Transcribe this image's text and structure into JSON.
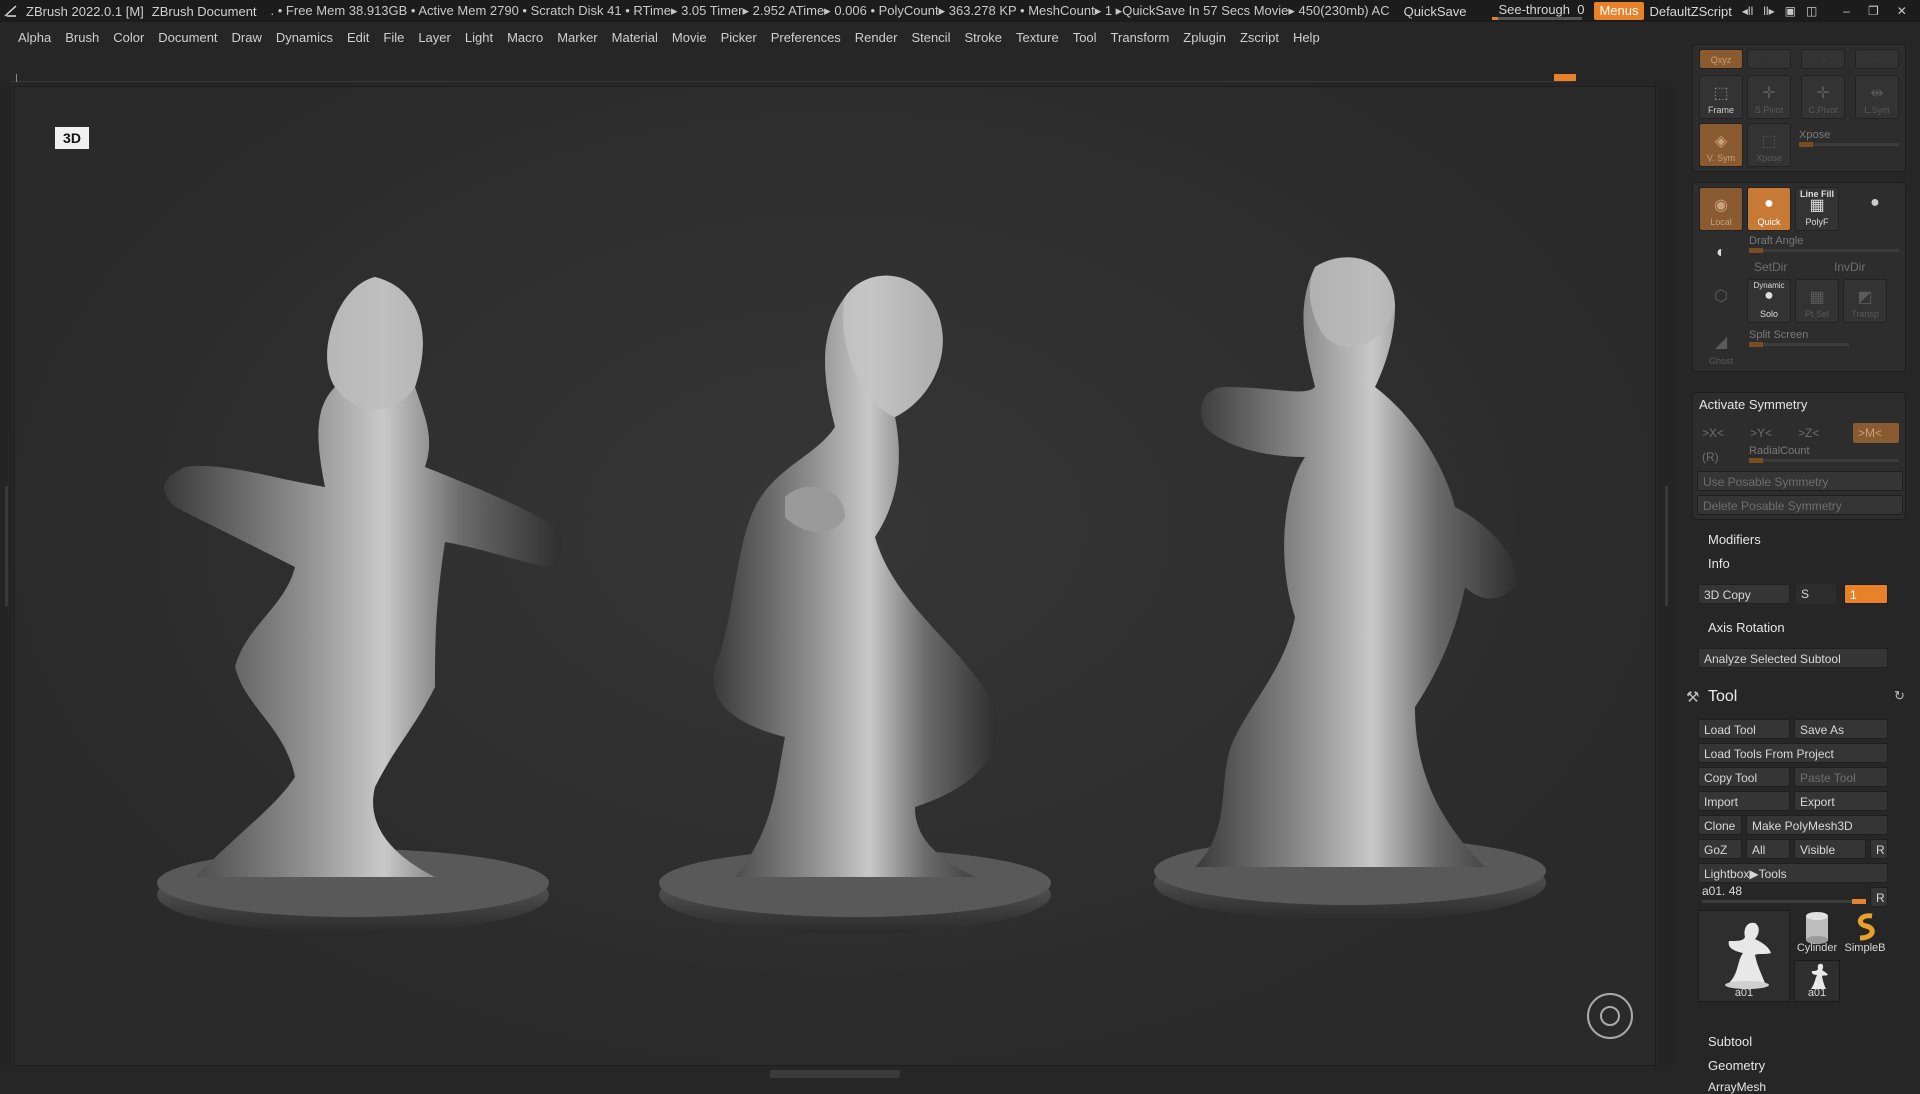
{
  "titlebar": {
    "app": "ZBrush 2022.0.1 [M]",
    "document": "ZBrush Document",
    "stats": ". • Free Mem 38.913GB • Active Mem 2790 • Scratch Disk 41 • RTime▸ 3.05 Timer▸ 2.952 ATime▸ 0.006 • PolyCount▸ 363.278 KP • MeshCount▸ 1 ▸QuickSave In 57 Secs Movie▸ 450(230mb) AC",
    "quicksave": "QuickSave",
    "see_through_label": "See-through",
    "see_through_value": "0",
    "menus": "Menus",
    "script": "DefaultZScript"
  },
  "menu": [
    "Alpha",
    "Brush",
    "Color",
    "Document",
    "Draw",
    "Dynamics",
    "Edit",
    "File",
    "Layer",
    "Light",
    "Macro",
    "Marker",
    "Material",
    "Movie",
    "Picker",
    "Preferences",
    "Render",
    "Stencil",
    "Stroke",
    "Texture",
    "Tool",
    "Transform",
    "Zplugin",
    "Zscript",
    "Help"
  ],
  "canvas": {
    "badge": "3D"
  },
  "panel_top": {
    "xyz": "Qxyz",
    "frame": "Frame",
    "spivot": "S.Pivot",
    "cpivot": "C.Pivot",
    "lsym": "L.Sym",
    "vsym": "V. Sym",
    "xpose_btn": "Xpose",
    "xpose_label": "Xpose"
  },
  "panel_view": {
    "local": "Local",
    "quick": "Quick",
    "linefill": "Line Fill",
    "polyf": "PolyF",
    "draft_angle": "Draft Angle",
    "setdir": "SetDir",
    "invdir": "InvDir",
    "dynamic": "Dynamic",
    "solo": "Solo",
    "ptsel": "Pt Sel",
    "transp": "Transp",
    "ghost": "Ghost",
    "split_screen": "Split Screen"
  },
  "symmetry": {
    "activate": "Activate Symmetry",
    "x": ">X<",
    "y": ">Y<",
    "z": ">Z<",
    "m": ">M<",
    "r": "(R)",
    "radial": "RadialCount",
    "use_posable": "Use Posable Symmetry",
    "delete_posable": "Delete Posable Symmetry"
  },
  "sections": {
    "modifiers": "Modifiers",
    "info": "Info",
    "copy3d": "3D Copy",
    "s": "S",
    "copy_value": "1",
    "axis_rotation": "Axis Rotation",
    "analyze": "Analyze Selected Subtool"
  },
  "tool": {
    "title": "Tool",
    "load_tool": "Load Tool",
    "save_as": "Save As",
    "load_from_project": "Load Tools From Project",
    "copy_tool": "Copy Tool",
    "paste_tool": "Paste Tool",
    "import": "Import",
    "export": "Export",
    "clone": "Clone",
    "make_polymesh": "Make PolyMesh3D",
    "goz": "GoZ",
    "all": "All",
    "visible": "Visible",
    "r": "R",
    "lightbox": "Lightbox▶Tools",
    "current": "a01. 48",
    "current_r": "R",
    "thumb_main": "a01",
    "thumb_cylinder": "Cylinder",
    "thumb_simple": "SimpleB",
    "thumb_small": "a01",
    "subtool": "Subtool",
    "geometry": "Geometry",
    "arraymesh": "ArrayMesh"
  },
  "colors": {
    "accent": "#e8822a",
    "bg": "#262626"
  }
}
